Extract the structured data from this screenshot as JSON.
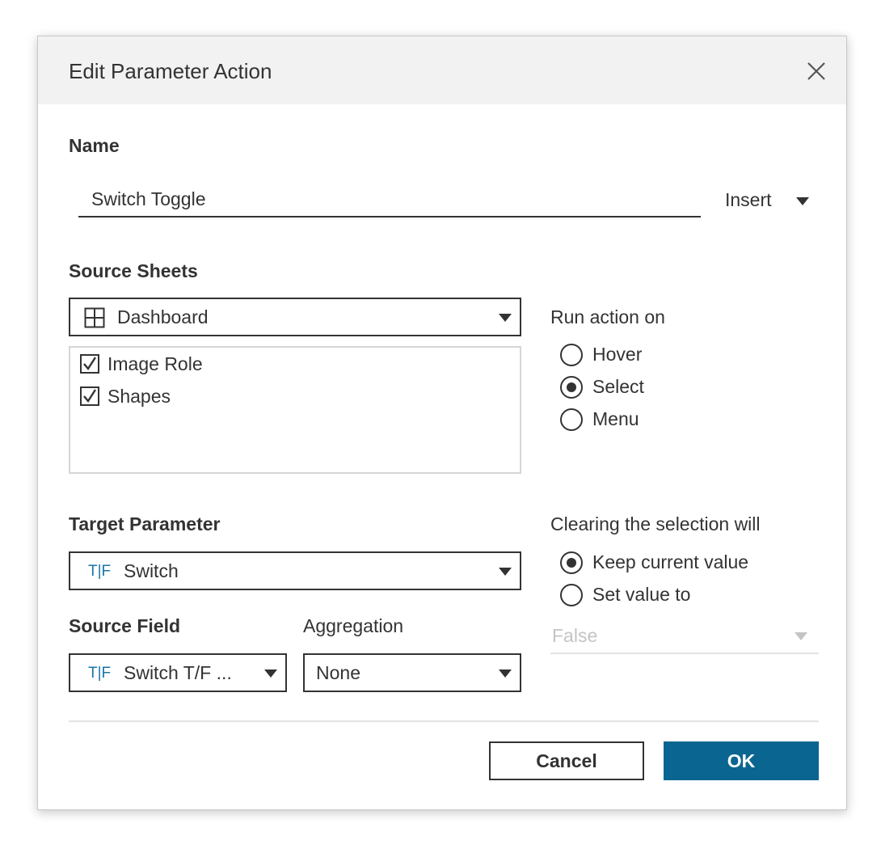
{
  "dialog": {
    "title": "Edit Parameter Action",
    "close_icon": "close-icon"
  },
  "name_section": {
    "label": "Name",
    "value": "Switch Toggle",
    "insert_label": "Insert"
  },
  "source_sheets": {
    "label": "Source Sheets",
    "dropdown_value": "Dashboard",
    "dropdown_icon": "dashboard-grid-icon",
    "sheets": [
      {
        "label": "Image Role",
        "checked": true
      },
      {
        "label": "Shapes",
        "checked": true
      }
    ]
  },
  "run_action": {
    "label": "Run action on",
    "options": [
      {
        "label": "Hover",
        "selected": false
      },
      {
        "label": "Select",
        "selected": true
      },
      {
        "label": "Menu",
        "selected": false
      }
    ]
  },
  "target_parameter": {
    "label": "Target Parameter",
    "type_icon_left": "T",
    "type_icon_right": "F",
    "value": "Switch"
  },
  "source_field": {
    "label": "Source Field",
    "type_icon_left": "T",
    "type_icon_right": "F",
    "value": "Switch T/F ..."
  },
  "aggregation": {
    "label": "Aggregation",
    "value": "None"
  },
  "clearing": {
    "label": "Clearing the selection will",
    "options": [
      {
        "label": "Keep current value",
        "selected": true
      },
      {
        "label": "Set value to",
        "selected": false
      }
    ],
    "set_value": "False"
  },
  "buttons": {
    "cancel": "Cancel",
    "ok": "OK"
  },
  "colors": {
    "accent": "#0a6690",
    "type_icon": "#1a76a8",
    "disabled_text": "#c4c4c4"
  }
}
